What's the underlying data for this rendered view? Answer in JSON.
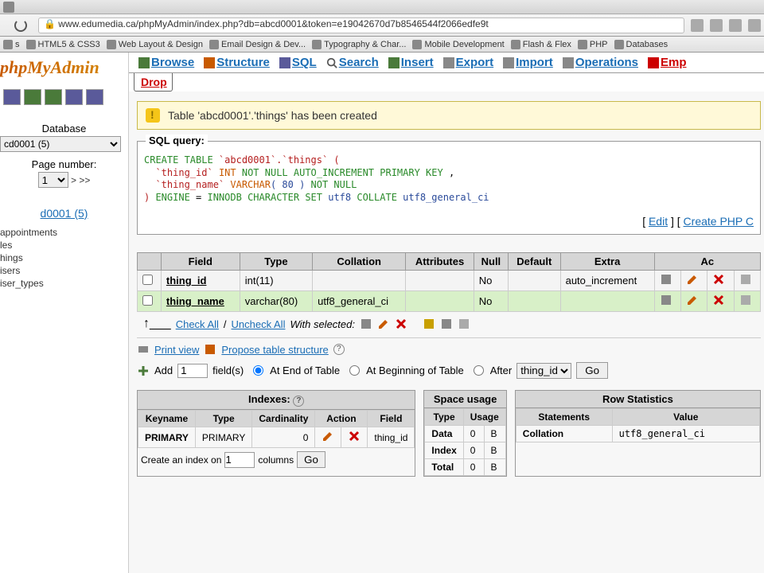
{
  "browser": {
    "url": "www.edumedia.ca/phpMyAdmin/index.php?db=abcd0001&token=e19042670d7b8546544f2066edfe9t",
    "bookmarks": [
      "s",
      "HTML5 & CSS3",
      "Web Layout & Design",
      "Email Design & Dev...",
      "Typography & Char...",
      "Mobile Development",
      "Flash & Flex",
      "PHP",
      "Databases"
    ]
  },
  "sidebar": {
    "logo": "phpMyAdmin",
    "db_label": "Database",
    "db_selected": "cd0001 (5)",
    "page_num_label": "Page number:",
    "page_num": "1",
    "pager": "> >>",
    "db_link": "d0001 (5)",
    "tables": [
      "appointments",
      "les",
      "hings",
      "isers",
      "iser_types"
    ]
  },
  "tabs": {
    "browse": "Browse",
    "structure": "Structure",
    "sql": "SQL",
    "search": "Search",
    "insert": "Insert",
    "export": "Export",
    "import": "Import",
    "operations": "Operations",
    "emp": "Emp",
    "drop": "Drop"
  },
  "message": "Table 'abcd0001'.'things' has been created",
  "sql": {
    "label": "SQL query:",
    "l1a": "CREATE TABLE",
    "l1b": " `abcd0001`.`things` (",
    "l2a": "`thing_id` ",
    "l2b": "INT",
    "l2c": " NOT NULL AUTO_INCREMENT PRIMARY KEY",
    "l2d": " ,",
    "l3a": "`thing_name` ",
    "l3b": "VARCHAR",
    "l3c": "( 80 )",
    "l3d": " NOT NULL",
    "l4a": ") ",
    "l4b": "ENGINE",
    "l4c": " = ",
    "l4d": "INNODB CHARACTER SET",
    "l4e": " utf8 ",
    "l4f": "COLLATE",
    "l4g": " utf8_general_ci",
    "edit": "Edit",
    "create_php": "Create PHP C"
  },
  "struct": {
    "headers": [
      "Field",
      "Type",
      "Collation",
      "Attributes",
      "Null",
      "Default",
      "Extra",
      "Ac"
    ],
    "rows": [
      {
        "field": "thing_id",
        "type": "int(11)",
        "collation": "",
        "attrs": "",
        "null": "No",
        "default": "",
        "extra": "auto_increment"
      },
      {
        "field": "thing_name",
        "type": "varchar(80)",
        "collation": "utf8_general_ci",
        "attrs": "",
        "null": "No",
        "default": "",
        "extra": ""
      }
    ],
    "check_all": "Check All",
    "uncheck_all": "Uncheck All",
    "with_selected": "With selected:"
  },
  "tools": {
    "print_view": "Print view",
    "propose": "Propose table structure",
    "add": "Add",
    "add_n": "1",
    "fields": "field(s)",
    "at_end": "At End of Table",
    "at_begin": "At Beginning of Table",
    "after": "After",
    "after_field": "thing_id",
    "go": "Go"
  },
  "indexes": {
    "title": "Indexes:",
    "headers": [
      "Keyname",
      "Type",
      "Cardinality",
      "Action",
      "Field"
    ],
    "row": {
      "keyname": "PRIMARY",
      "type": "PRIMARY",
      "card": "0",
      "field": "thing_id"
    },
    "create": "Create an index on",
    "create_n": "1",
    "cols": "columns",
    "go": "Go"
  },
  "space": {
    "title": "Space usage",
    "headers": [
      "Type",
      "Usage"
    ],
    "rows": [
      {
        "type": "Data",
        "val": "0",
        "unit": "B"
      },
      {
        "type": "Index",
        "val": "0",
        "unit": "B"
      },
      {
        "type": "Total",
        "val": "0",
        "unit": "B"
      }
    ]
  },
  "stats": {
    "title": "Row Statistics",
    "headers": [
      "Statements",
      "Value"
    ],
    "rows": [
      {
        "stmt": "Collation",
        "val": "utf8_general_ci"
      }
    ]
  }
}
